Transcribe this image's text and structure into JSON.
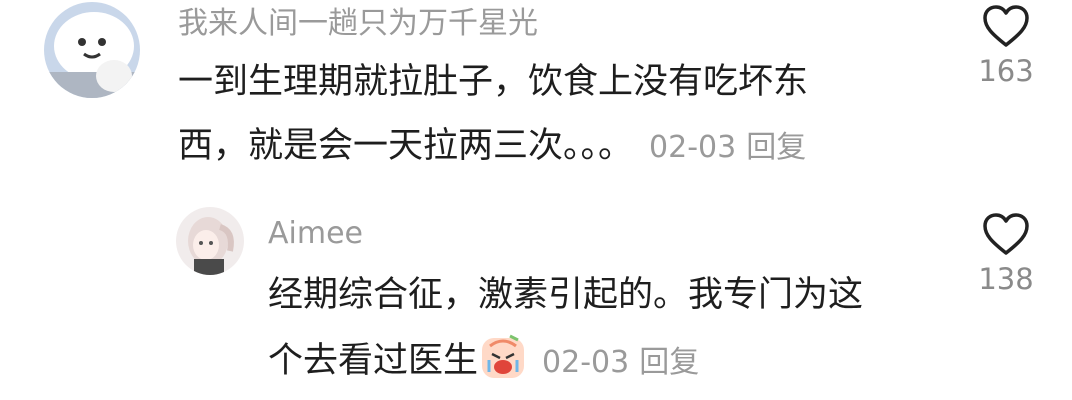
{
  "comments": [
    {
      "username": "我来人间一趟只为万千星光",
      "text_lines": [
        "一到生理期就拉肚子，饮食上没有吃坏东",
        "西，就是会一天拉两三次。。。"
      ],
      "date": "02-03",
      "reply_label": "回复",
      "likes": "163",
      "avatar_icon": "cartoon-bun-avatar"
    },
    {
      "username": "Aimee",
      "text_lines": [
        "经期综合征，激素引起的。我专门为这",
        "个去看过医生"
      ],
      "date": "02-03",
      "reply_label": "回复",
      "likes": "138",
      "avatar_icon": "anime-girl-avatar",
      "emoji_icon": "crying-face-emoji"
    }
  ],
  "colors": {
    "username": "#9a9a9a",
    "text": "#1e1e1e",
    "meta": "#9a9a9a"
  }
}
